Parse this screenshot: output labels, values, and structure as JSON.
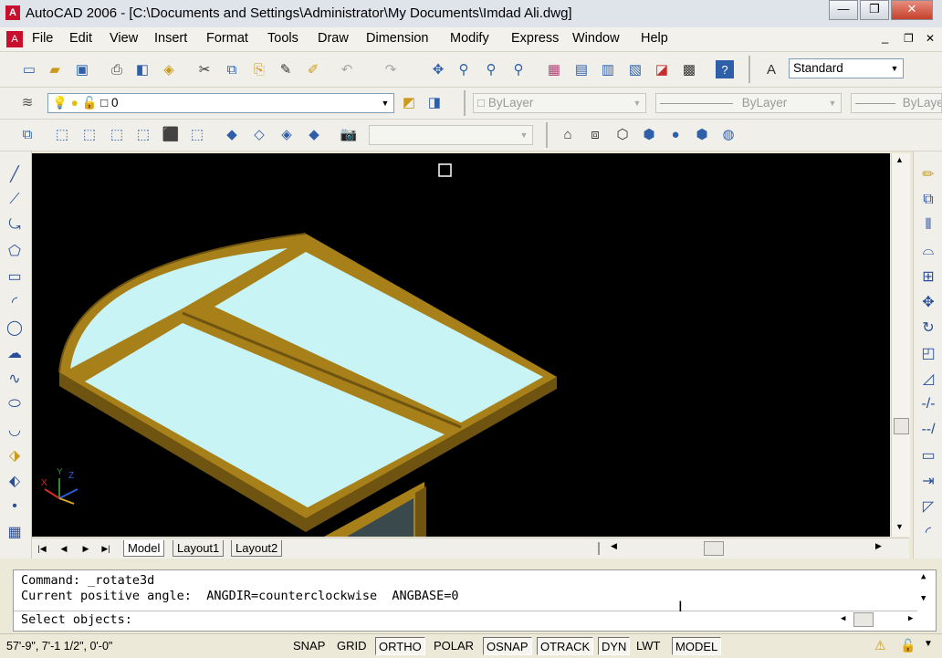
{
  "window": {
    "title": "AutoCAD 2006 - [C:\\Documents and Settings\\Administrator\\My Documents\\Imdad Ali.dwg]",
    "minimize": "—",
    "restore": "❐",
    "close": "✕"
  },
  "menu": {
    "items": [
      "File",
      "Edit",
      "View",
      "Insert",
      "Format",
      "Tools",
      "Draw",
      "Dimension",
      "Modify",
      "Express",
      "Window",
      "Help"
    ]
  },
  "doc_controls": {
    "minimize": "_",
    "restore": "❐",
    "close": "✕"
  },
  "toolbar": {
    "text_style": "Standard",
    "layer": "0",
    "color": "ByLayer",
    "linetype": "ByLayer",
    "lineweight": "ByLayer",
    "ucs_combo": ""
  },
  "layout_tabs": [
    "Model",
    "Layout1",
    "Layout2"
  ],
  "command": {
    "line1": "Command: _rotate3d",
    "line2": "Current positive angle:  ANGDIR=counterclockwise  ANGBASE=0",
    "prompt": "Select objects:"
  },
  "ucs": {
    "x": "X",
    "y": "Y",
    "z": "Z"
  },
  "status": {
    "coordinates": "57'-9\",  7'-1 1/2\", 0'-0\"",
    "buttons": [
      {
        "label": "SNAP",
        "on": false
      },
      {
        "label": "GRID",
        "on": false
      },
      {
        "label": "ORTHO",
        "on": true
      },
      {
        "label": "POLAR",
        "on": false
      },
      {
        "label": "OSNAP",
        "on": true
      },
      {
        "label": "OTRACK",
        "on": true
      },
      {
        "label": "DYN",
        "on": true
      },
      {
        "label": "LWT",
        "on": false
      },
      {
        "label": "MODEL",
        "on": true
      }
    ]
  },
  "colors": {
    "viewport_bg": "#000000",
    "frame_wood": "#a8801a",
    "frame_dark": "#6e5410",
    "glass": "#c8f4f6"
  }
}
